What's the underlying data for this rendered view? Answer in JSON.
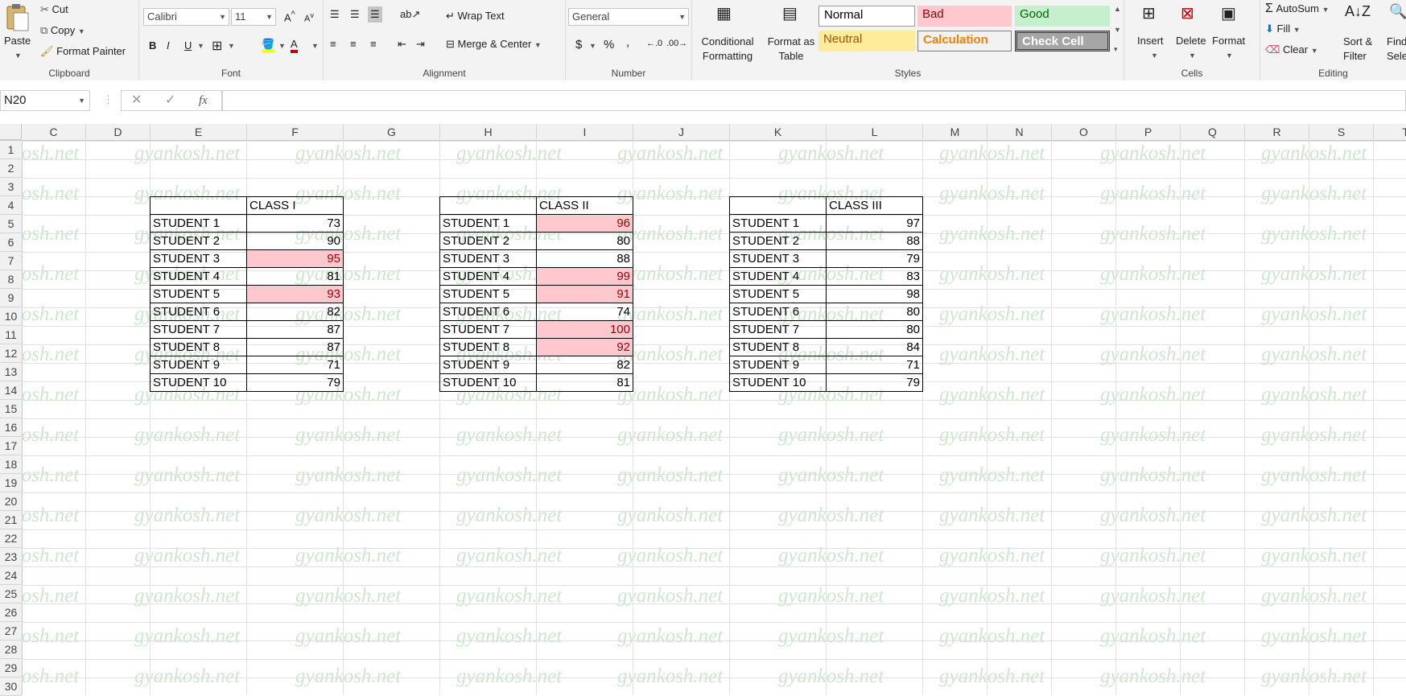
{
  "ribbon": {
    "clipboard": {
      "label": "Clipboard",
      "paste": "Paste",
      "cut": "Cut",
      "copy": "Copy",
      "format_painter": "Format Painter"
    },
    "font": {
      "label": "Font",
      "name": "Calibri",
      "size": "11",
      "bold": "B",
      "italic": "I",
      "underline": "U"
    },
    "alignment": {
      "label": "Alignment",
      "wrap_text": "Wrap Text",
      "merge_center": "Merge & Center"
    },
    "number": {
      "label": "Number",
      "format": "General",
      "currency": "$",
      "percent": "%",
      "comma": ","
    },
    "styles": {
      "label": "Styles",
      "conditional_formatting": "Conditional Formatting",
      "format_as_table": "Format as Table",
      "normal": "Normal",
      "bad": "Bad",
      "good": "Good",
      "neutral": "Neutral",
      "calculation": "Calculation",
      "check_cell": "Check Cell"
    },
    "cells": {
      "label": "Cells",
      "insert": "Insert",
      "delete": "Delete",
      "format": "Format"
    },
    "editing": {
      "label": "Editing",
      "autosum": "AutoSum",
      "fill": "Fill",
      "clear": "Clear",
      "sort_filter": "Sort & Filter",
      "find_select": "Find & Select"
    }
  },
  "formula_bar": {
    "name_box": "N20",
    "fx": "fx",
    "value": ""
  },
  "columns": [
    "C",
    "D",
    "E",
    "F",
    "G",
    "H",
    "I",
    "J",
    "K",
    "L",
    "M",
    "N",
    "O",
    "P",
    "Q",
    "R",
    "S",
    "T"
  ],
  "rows": [
    "1",
    "2",
    "3",
    "4",
    "5",
    "6",
    "7",
    "8",
    "9",
    "10",
    "11",
    "12",
    "13",
    "14",
    "15",
    "16",
    "17",
    "18",
    "19",
    "20",
    "21",
    "22",
    "23",
    "24",
    "25",
    "26",
    "27",
    "28",
    "29",
    "30"
  ],
  "watermark": "gyankosh.net",
  "tables": [
    {
      "header": "CLASS I",
      "rows": [
        {
          "name": "STUDENT 1",
          "score": "73",
          "bad": false
        },
        {
          "name": "STUDENT 2",
          "score": "90",
          "bad": false
        },
        {
          "name": "STUDENT 3",
          "score": "95",
          "bad": true
        },
        {
          "name": "STUDENT 4",
          "score": "81",
          "bad": false
        },
        {
          "name": "STUDENT 5",
          "score": "93",
          "bad": true
        },
        {
          "name": "STUDENT 6",
          "score": "82",
          "bad": false
        },
        {
          "name": "STUDENT 7",
          "score": "87",
          "bad": false
        },
        {
          "name": "STUDENT 8",
          "score": "87",
          "bad": false
        },
        {
          "name": "STUDENT 9",
          "score": "71",
          "bad": false
        },
        {
          "name": "STUDENT 10",
          "score": "79",
          "bad": false
        }
      ]
    },
    {
      "header": "CLASS II",
      "rows": [
        {
          "name": "STUDENT 1",
          "score": "96",
          "bad": true
        },
        {
          "name": "STUDENT 2",
          "score": "80",
          "bad": false
        },
        {
          "name": "STUDENT 3",
          "score": "88",
          "bad": false
        },
        {
          "name": "STUDENT 4",
          "score": "99",
          "bad": true
        },
        {
          "name": "STUDENT 5",
          "score": "91",
          "bad": true
        },
        {
          "name": "STUDENT 6",
          "score": "74",
          "bad": false
        },
        {
          "name": "STUDENT 7",
          "score": "100",
          "bad": true
        },
        {
          "name": "STUDENT 8",
          "score": "92",
          "bad": true
        },
        {
          "name": "STUDENT 9",
          "score": "82",
          "bad": false
        },
        {
          "name": "STUDENT 10",
          "score": "81",
          "bad": false
        }
      ]
    },
    {
      "header": "CLASS III",
      "rows": [
        {
          "name": "STUDENT 1",
          "score": "97",
          "bad": false
        },
        {
          "name": "STUDENT 2",
          "score": "88",
          "bad": false
        },
        {
          "name": "STUDENT 3",
          "score": "79",
          "bad": false
        },
        {
          "name": "STUDENT 4",
          "score": "83",
          "bad": false
        },
        {
          "name": "STUDENT 5",
          "score": "98",
          "bad": false
        },
        {
          "name": "STUDENT 6",
          "score": "80",
          "bad": false
        },
        {
          "name": "STUDENT 7",
          "score": "80",
          "bad": false
        },
        {
          "name": "STUDENT 8",
          "score": "84",
          "bad": false
        },
        {
          "name": "STUDENT 9",
          "score": "71",
          "bad": false
        },
        {
          "name": "STUDENT 10",
          "score": "79",
          "bad": false
        }
      ]
    }
  ]
}
